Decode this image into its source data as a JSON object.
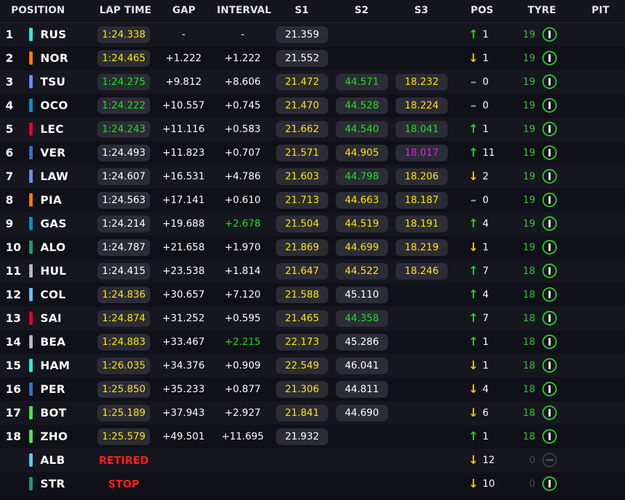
{
  "columns": [
    "POSITION",
    "LAP TIME",
    "GAP",
    "INTERVAL",
    "S1",
    "S2",
    "S3",
    "POS",
    "TYRE",
    "PIT"
  ],
  "colors": {
    "yellow": "#ffe600",
    "green": "#1fe01f",
    "purple": "#e01fe0",
    "white": "#ffffff",
    "up": "#23d123",
    "down": "#ffc400",
    "flat": "#9a9aa2",
    "tyre_laps": "#2fc42f",
    "laps_dim": "#4a4a50",
    "retired": "#ff1e1e"
  },
  "rows": [
    {
      "pos": "1",
      "driver": "RUS",
      "team_color": "#27f4d2",
      "lap": "1:24.338",
      "lap_c": "yellow",
      "gap": "-",
      "interval": "-",
      "int_c": "white",
      "s1": "21.359",
      "s1_c": "white",
      "s2": "",
      "s2_c": "white",
      "s3": "",
      "s3_c": "white",
      "dir": "up",
      "change": "1",
      "laps": "19"
    },
    {
      "pos": "2",
      "driver": "NOR",
      "team_color": "#ff8000",
      "lap": "1:24.465",
      "lap_c": "yellow",
      "gap": "+1.222",
      "interval": "+1.222",
      "int_c": "white",
      "s1": "21.552",
      "s1_c": "white",
      "s2": "",
      "s2_c": "white",
      "s3": "",
      "s3_c": "white",
      "dir": "down",
      "change": "1",
      "laps": "19"
    },
    {
      "pos": "3",
      "driver": "TSU",
      "team_color": "#6692ff",
      "lap": "1:24.275",
      "lap_c": "green",
      "gap": "+9.812",
      "interval": "+8.606",
      "int_c": "white",
      "s1": "21.472",
      "s1_c": "yellow",
      "s2": "44.571",
      "s2_c": "green",
      "s3": "18.232",
      "s3_c": "yellow",
      "dir": "flat",
      "change": "0",
      "laps": "19"
    },
    {
      "pos": "4",
      "driver": "OCO",
      "team_color": "#0093cc",
      "lap": "1:24.222",
      "lap_c": "green",
      "gap": "+10.557",
      "interval": "+0.745",
      "int_c": "white",
      "s1": "21.470",
      "s1_c": "yellow",
      "s2": "44.528",
      "s2_c": "green",
      "s3": "18.224",
      "s3_c": "yellow",
      "dir": "flat",
      "change": "0",
      "laps": "19"
    },
    {
      "pos": "5",
      "driver": "LEC",
      "team_color": "#e8002d",
      "lap": "1:24.243",
      "lap_c": "green",
      "gap": "+11.116",
      "interval": "+0.583",
      "int_c": "white",
      "s1": "21.662",
      "s1_c": "yellow",
      "s2": "44.540",
      "s2_c": "green",
      "s3": "18.041",
      "s3_c": "green",
      "dir": "up",
      "change": "1",
      "laps": "19"
    },
    {
      "pos": "6",
      "driver": "VER",
      "team_color": "#3671c6",
      "lap": "1:24.493",
      "lap_c": "white",
      "gap": "+11.823",
      "interval": "+0.707",
      "int_c": "white",
      "s1": "21.571",
      "s1_c": "yellow",
      "s2": "44.905",
      "s2_c": "yellow",
      "s3": "18.017",
      "s3_c": "purple",
      "dir": "up",
      "change": "11",
      "laps": "19"
    },
    {
      "pos": "7",
      "driver": "LAW",
      "team_color": "#6692ff",
      "lap": "1:24.607",
      "lap_c": "white",
      "gap": "+16.531",
      "interval": "+4.786",
      "int_c": "white",
      "s1": "21.603",
      "s1_c": "yellow",
      "s2": "44.798",
      "s2_c": "green",
      "s3": "18.206",
      "s3_c": "yellow",
      "dir": "down",
      "change": "2",
      "laps": "19"
    },
    {
      "pos": "8",
      "driver": "PIA",
      "team_color": "#ff8000",
      "lap": "1:24.563",
      "lap_c": "white",
      "gap": "+17.141",
      "interval": "+0.610",
      "int_c": "white",
      "s1": "21.713",
      "s1_c": "yellow",
      "s2": "44.663",
      "s2_c": "yellow",
      "s3": "18.187",
      "s3_c": "yellow",
      "dir": "flat",
      "change": "0",
      "laps": "19"
    },
    {
      "pos": "9",
      "driver": "GAS",
      "team_color": "#0093cc",
      "lap": "1:24.214",
      "lap_c": "white",
      "gap": "+19.688",
      "interval": "+2.678",
      "int_c": "green",
      "s1": "21.504",
      "s1_c": "yellow",
      "s2": "44.519",
      "s2_c": "yellow",
      "s3": "18.191",
      "s3_c": "yellow",
      "dir": "up",
      "change": "4",
      "laps": "19"
    },
    {
      "pos": "10",
      "driver": "ALO",
      "team_color": "#229971",
      "lap": "1:24.787",
      "lap_c": "white",
      "gap": "+21.658",
      "interval": "+1.970",
      "int_c": "white",
      "s1": "21.869",
      "s1_c": "yellow",
      "s2": "44.699",
      "s2_c": "yellow",
      "s3": "18.219",
      "s3_c": "yellow",
      "dir": "down",
      "change": "1",
      "laps": "19"
    },
    {
      "pos": "11",
      "driver": "HUL",
      "team_color": "#b6babd",
      "lap": "1:24.415",
      "lap_c": "white",
      "gap": "+23.538",
      "interval": "+1.814",
      "int_c": "white",
      "s1": "21.647",
      "s1_c": "yellow",
      "s2": "44.522",
      "s2_c": "yellow",
      "s3": "18.246",
      "s3_c": "yellow",
      "dir": "up",
      "change": "7",
      "laps": "18"
    },
    {
      "pos": "12",
      "driver": "COL",
      "team_color": "#64c4ff",
      "lap": "1:24.836",
      "lap_c": "yellow",
      "gap": "+30.657",
      "interval": "+7.120",
      "int_c": "white",
      "s1": "21.588",
      "s1_c": "yellow",
      "s2": "45.110",
      "s2_c": "white",
      "s3": "",
      "s3_c": "white",
      "dir": "up",
      "change": "4",
      "laps": "18"
    },
    {
      "pos": "13",
      "driver": "SAI",
      "team_color": "#e8002d",
      "lap": "1:24.874",
      "lap_c": "yellow",
      "gap": "+31.252",
      "interval": "+0.595",
      "int_c": "white",
      "s1": "21.465",
      "s1_c": "yellow",
      "s2": "44.358",
      "s2_c": "green",
      "s3": "",
      "s3_c": "white",
      "dir": "up",
      "change": "7",
      "laps": "18"
    },
    {
      "pos": "14",
      "driver": "BEA",
      "team_color": "#b6babd",
      "lap": "1:24.883",
      "lap_c": "yellow",
      "gap": "+33.467",
      "interval": "+2.215",
      "int_c": "green",
      "s1": "22.173",
      "s1_c": "yellow",
      "s2": "45.286",
      "s2_c": "white",
      "s3": "",
      "s3_c": "white",
      "dir": "up",
      "change": "1",
      "laps": "18"
    },
    {
      "pos": "15",
      "driver": "HAM",
      "team_color": "#27f4d2",
      "lap": "1:26.035",
      "lap_c": "yellow",
      "gap": "+34.376",
      "interval": "+0.909",
      "int_c": "white",
      "s1": "22.549",
      "s1_c": "yellow",
      "s2": "46.041",
      "s2_c": "white",
      "s3": "",
      "s3_c": "white",
      "dir": "down",
      "change": "1",
      "laps": "18"
    },
    {
      "pos": "16",
      "driver": "PER",
      "team_color": "#3671c6",
      "lap": "1:25.850",
      "lap_c": "yellow",
      "gap": "+35.233",
      "interval": "+0.877",
      "int_c": "white",
      "s1": "21.306",
      "s1_c": "yellow",
      "s2": "44.811",
      "s2_c": "white",
      "s3": "",
      "s3_c": "white",
      "dir": "down",
      "change": "4",
      "laps": "18"
    },
    {
      "pos": "17",
      "driver": "BOT",
      "team_color": "#52e252",
      "lap": "1:25.189",
      "lap_c": "yellow",
      "gap": "+37.943",
      "interval": "+2.927",
      "int_c": "white",
      "s1": "21.841",
      "s1_c": "yellow",
      "s2": "44.690",
      "s2_c": "white",
      "s3": "",
      "s3_c": "white",
      "dir": "down",
      "change": "6",
      "laps": "18"
    },
    {
      "pos": "18",
      "driver": "ZHO",
      "team_color": "#52e252",
      "lap": "1:25.579",
      "lap_c": "yellow",
      "gap": "+49.501",
      "interval": "+11.695",
      "int_c": "white",
      "s1": "21.932",
      "s1_c": "white",
      "s2": "",
      "s2_c": "white",
      "s3": "",
      "s3_c": "white",
      "dir": "up",
      "change": "1",
      "laps": "18"
    },
    {
      "pos": "",
      "driver": "ALB",
      "team_color": "#64c4ff",
      "status": "RETIRED",
      "dir": "down",
      "change": "12",
      "laps": "0",
      "tyre_off": true
    },
    {
      "pos": "",
      "driver": "STR",
      "team_color": "#229971",
      "status": "STOP",
      "dir": "down",
      "change": "10",
      "laps": "0",
      "tyre_off": false
    }
  ]
}
